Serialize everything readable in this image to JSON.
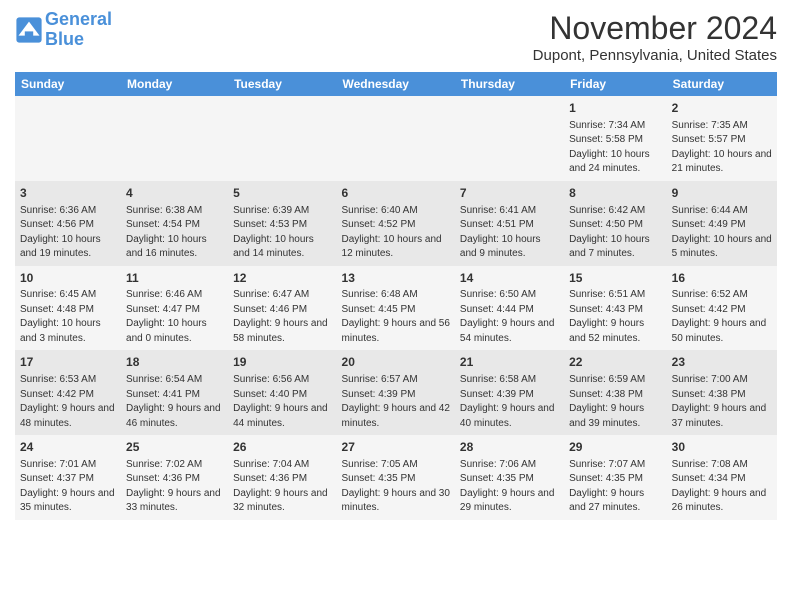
{
  "header": {
    "logo_line1": "General",
    "logo_line2": "Blue",
    "month_title": "November 2024",
    "subtitle": "Dupont, Pennsylvania, United States"
  },
  "days_of_week": [
    "Sunday",
    "Monday",
    "Tuesday",
    "Wednesday",
    "Thursday",
    "Friday",
    "Saturday"
  ],
  "weeks": [
    [
      {
        "day": "",
        "info": ""
      },
      {
        "day": "",
        "info": ""
      },
      {
        "day": "",
        "info": ""
      },
      {
        "day": "",
        "info": ""
      },
      {
        "day": "",
        "info": ""
      },
      {
        "day": "1",
        "info": "Sunrise: 7:34 AM\nSunset: 5:58 PM\nDaylight: 10 hours and 24 minutes."
      },
      {
        "day": "2",
        "info": "Sunrise: 7:35 AM\nSunset: 5:57 PM\nDaylight: 10 hours and 21 minutes."
      }
    ],
    [
      {
        "day": "3",
        "info": "Sunrise: 6:36 AM\nSunset: 4:56 PM\nDaylight: 10 hours and 19 minutes."
      },
      {
        "day": "4",
        "info": "Sunrise: 6:38 AM\nSunset: 4:54 PM\nDaylight: 10 hours and 16 minutes."
      },
      {
        "day": "5",
        "info": "Sunrise: 6:39 AM\nSunset: 4:53 PM\nDaylight: 10 hours and 14 minutes."
      },
      {
        "day": "6",
        "info": "Sunrise: 6:40 AM\nSunset: 4:52 PM\nDaylight: 10 hours and 12 minutes."
      },
      {
        "day": "7",
        "info": "Sunrise: 6:41 AM\nSunset: 4:51 PM\nDaylight: 10 hours and 9 minutes."
      },
      {
        "day": "8",
        "info": "Sunrise: 6:42 AM\nSunset: 4:50 PM\nDaylight: 10 hours and 7 minutes."
      },
      {
        "day": "9",
        "info": "Sunrise: 6:44 AM\nSunset: 4:49 PM\nDaylight: 10 hours and 5 minutes."
      }
    ],
    [
      {
        "day": "10",
        "info": "Sunrise: 6:45 AM\nSunset: 4:48 PM\nDaylight: 10 hours and 3 minutes."
      },
      {
        "day": "11",
        "info": "Sunrise: 6:46 AM\nSunset: 4:47 PM\nDaylight: 10 hours and 0 minutes."
      },
      {
        "day": "12",
        "info": "Sunrise: 6:47 AM\nSunset: 4:46 PM\nDaylight: 9 hours and 58 minutes."
      },
      {
        "day": "13",
        "info": "Sunrise: 6:48 AM\nSunset: 4:45 PM\nDaylight: 9 hours and 56 minutes."
      },
      {
        "day": "14",
        "info": "Sunrise: 6:50 AM\nSunset: 4:44 PM\nDaylight: 9 hours and 54 minutes."
      },
      {
        "day": "15",
        "info": "Sunrise: 6:51 AM\nSunset: 4:43 PM\nDaylight: 9 hours and 52 minutes."
      },
      {
        "day": "16",
        "info": "Sunrise: 6:52 AM\nSunset: 4:42 PM\nDaylight: 9 hours and 50 minutes."
      }
    ],
    [
      {
        "day": "17",
        "info": "Sunrise: 6:53 AM\nSunset: 4:42 PM\nDaylight: 9 hours and 48 minutes."
      },
      {
        "day": "18",
        "info": "Sunrise: 6:54 AM\nSunset: 4:41 PM\nDaylight: 9 hours and 46 minutes."
      },
      {
        "day": "19",
        "info": "Sunrise: 6:56 AM\nSunset: 4:40 PM\nDaylight: 9 hours and 44 minutes."
      },
      {
        "day": "20",
        "info": "Sunrise: 6:57 AM\nSunset: 4:39 PM\nDaylight: 9 hours and 42 minutes."
      },
      {
        "day": "21",
        "info": "Sunrise: 6:58 AM\nSunset: 4:39 PM\nDaylight: 9 hours and 40 minutes."
      },
      {
        "day": "22",
        "info": "Sunrise: 6:59 AM\nSunset: 4:38 PM\nDaylight: 9 hours and 39 minutes."
      },
      {
        "day": "23",
        "info": "Sunrise: 7:00 AM\nSunset: 4:38 PM\nDaylight: 9 hours and 37 minutes."
      }
    ],
    [
      {
        "day": "24",
        "info": "Sunrise: 7:01 AM\nSunset: 4:37 PM\nDaylight: 9 hours and 35 minutes."
      },
      {
        "day": "25",
        "info": "Sunrise: 7:02 AM\nSunset: 4:36 PM\nDaylight: 9 hours and 33 minutes."
      },
      {
        "day": "26",
        "info": "Sunrise: 7:04 AM\nSunset: 4:36 PM\nDaylight: 9 hours and 32 minutes."
      },
      {
        "day": "27",
        "info": "Sunrise: 7:05 AM\nSunset: 4:35 PM\nDaylight: 9 hours and 30 minutes."
      },
      {
        "day": "28",
        "info": "Sunrise: 7:06 AM\nSunset: 4:35 PM\nDaylight: 9 hours and 29 minutes."
      },
      {
        "day": "29",
        "info": "Sunrise: 7:07 AM\nSunset: 4:35 PM\nDaylight: 9 hours and 27 minutes."
      },
      {
        "day": "30",
        "info": "Sunrise: 7:08 AM\nSunset: 4:34 PM\nDaylight: 9 hours and 26 minutes."
      }
    ]
  ]
}
